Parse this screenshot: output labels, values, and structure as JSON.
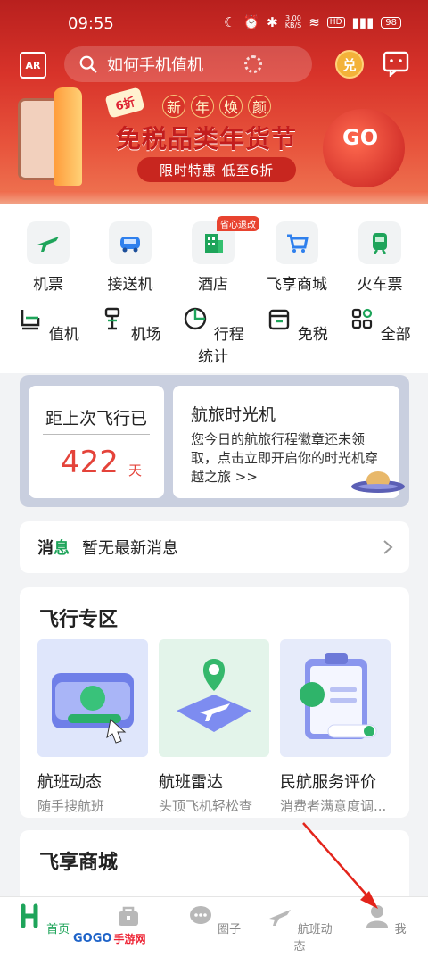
{
  "status_bar": {
    "time": "09:55",
    "net_speed": "3.00\nKB/S",
    "hd": "HD",
    "battery": "98"
  },
  "header": {
    "ar_label": "AR",
    "search_placeholder": "如何手机值机",
    "coin_label": "兑"
  },
  "banner": {
    "title_top": [
      "新",
      "年",
      "焕",
      "颜"
    ],
    "title": "免税品类年货节",
    "subtitle": "限时特惠 低至6折",
    "discount_tag": "6折",
    "go_text": "GO"
  },
  "services": [
    {
      "label": "机票",
      "icon": "plane-ticket-icon"
    },
    {
      "label": "接送机",
      "icon": "car-icon"
    },
    {
      "label": "酒店",
      "icon": "hotel-icon",
      "badge": "省心退改"
    },
    {
      "label": "飞享商城",
      "icon": "shopping-cart-icon"
    },
    {
      "label": "火车票",
      "icon": "train-icon"
    },
    {
      "label": "值机",
      "icon": "checkin-seat-icon"
    },
    {
      "label": "机场",
      "icon": "airport-icon"
    },
    {
      "label": "行程统计",
      "icon": "pie-chart-icon"
    },
    {
      "label": "免税",
      "icon": "duty-free-shop-icon"
    },
    {
      "label": "全部",
      "icon": "all-grid-icon"
    }
  ],
  "time_machine": {
    "since_label": "距上次飞行已",
    "days": "422",
    "unit": "天",
    "title": "航旅时光机",
    "desc": "您今日的航旅行程徽章还未领取，点击立即开启你的时光机穿越之旅 >>"
  },
  "news": {
    "tag_part1": "消",
    "tag_part2": "息",
    "text": "暂无最新消息"
  },
  "flight_zone": {
    "title": "飞行专区",
    "cards": [
      {
        "title": "航班动态",
        "subtitle": "随手搜航班"
      },
      {
        "title": "航班雷达",
        "subtitle": "头顶飞机轻松查"
      },
      {
        "title": "民航服务评价",
        "subtitle": "消费者满意度调..."
      }
    ]
  },
  "shop": {
    "title": "飞享商城"
  },
  "tabbar": [
    {
      "label": "首页",
      "icon": "home-icon",
      "active": true
    },
    {
      "label": "",
      "icon": "bag-icon"
    },
    {
      "label": "圈子",
      "icon": "chat-bubble-icon"
    },
    {
      "label": "航班动态",
      "icon": "plane-icon"
    },
    {
      "label": "我",
      "icon": "user-icon"
    }
  ],
  "watermark": {
    "part1": "GOGO",
    "part2": "手游网"
  },
  "colors": {
    "brand_green": "#1ea45a",
    "banner_red": "#d8332a",
    "days_red": "#e4433a",
    "annotation_arrow": "#e3241b"
  }
}
